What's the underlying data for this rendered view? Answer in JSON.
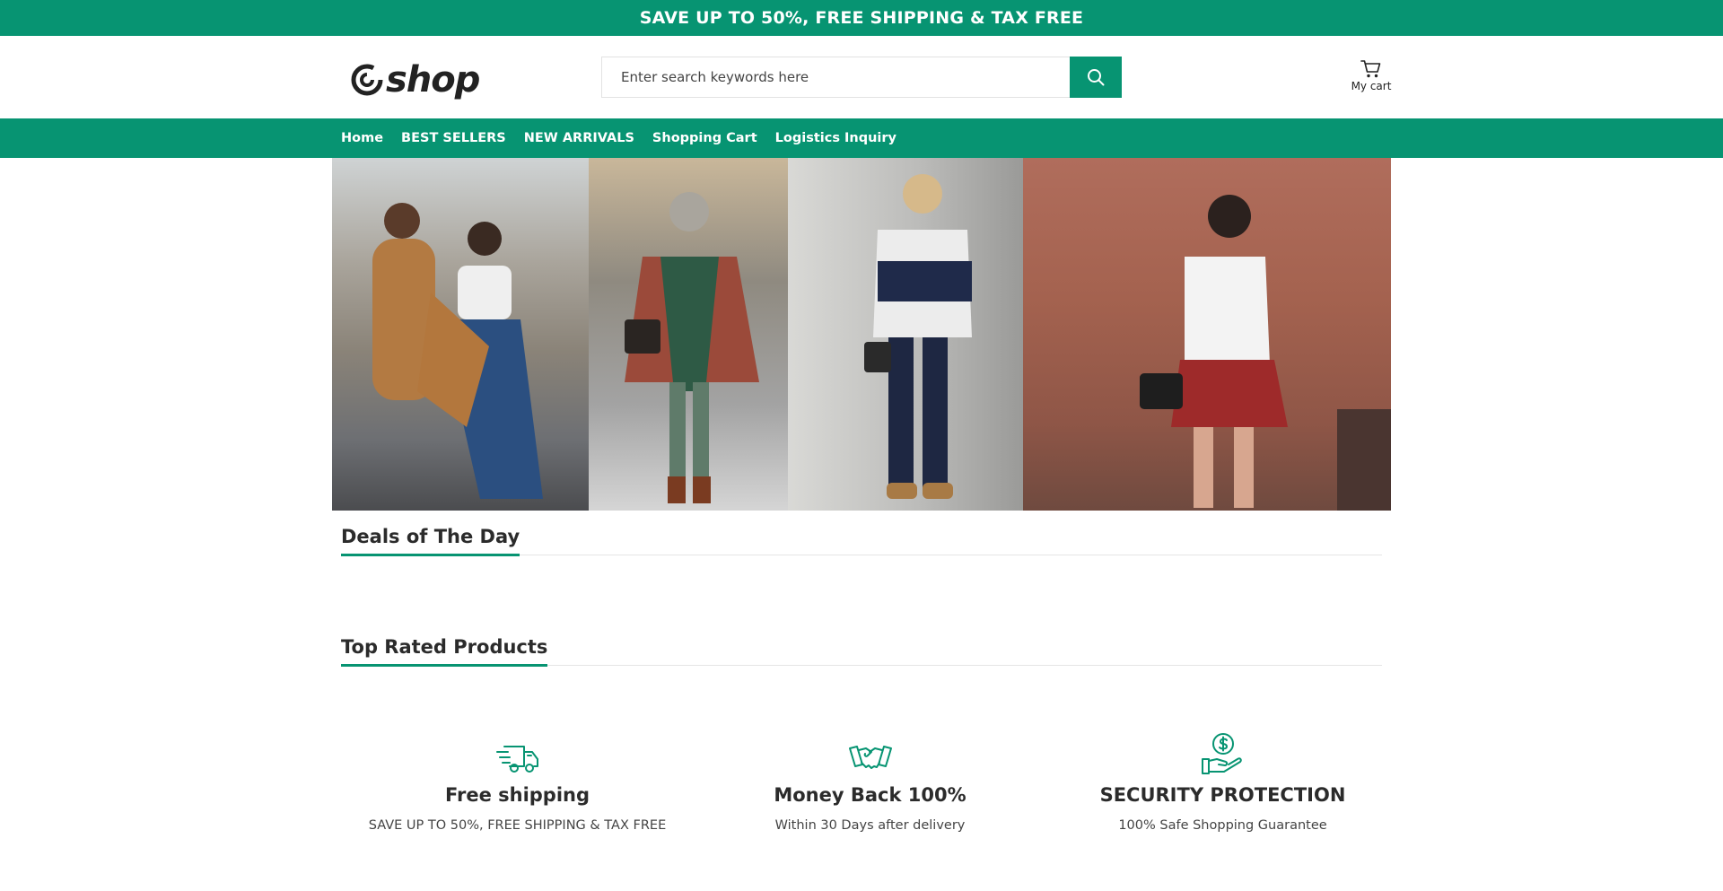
{
  "announcement": {
    "text": "SAVE UP TO 50%, FREE SHIPPING & TAX FREE"
  },
  "header": {
    "logo_text": "shop",
    "search": {
      "placeholder": "Enter search keywords here",
      "value": ""
    },
    "cart_label": "My cart"
  },
  "nav": {
    "items": [
      {
        "label": "Home"
      },
      {
        "label": "BEST SELLERS"
      },
      {
        "label": "NEW ARRIVALS"
      },
      {
        "label": "Shopping Cart"
      },
      {
        "label": "Logistics Inquiry"
      }
    ]
  },
  "sections": {
    "deals_title": "Deals of The Day",
    "top_rated_title": "Top Rated Products"
  },
  "features": [
    {
      "icon": "truck-icon",
      "title": "Free shipping",
      "description": "SAVE UP TO 50%, FREE SHIPPING & TAX FREE"
    },
    {
      "icon": "handshake-icon",
      "title": "Money Back 100%",
      "description": "Within 30 Days after delivery"
    },
    {
      "icon": "dollar-hand-icon",
      "title": "SECURITY PROTECTION",
      "description": "100% Safe Shopping Guarantee"
    }
  ],
  "colors": {
    "brand": "#079472",
    "text": "#2b2b2b",
    "divider": "#e5e5e5"
  }
}
